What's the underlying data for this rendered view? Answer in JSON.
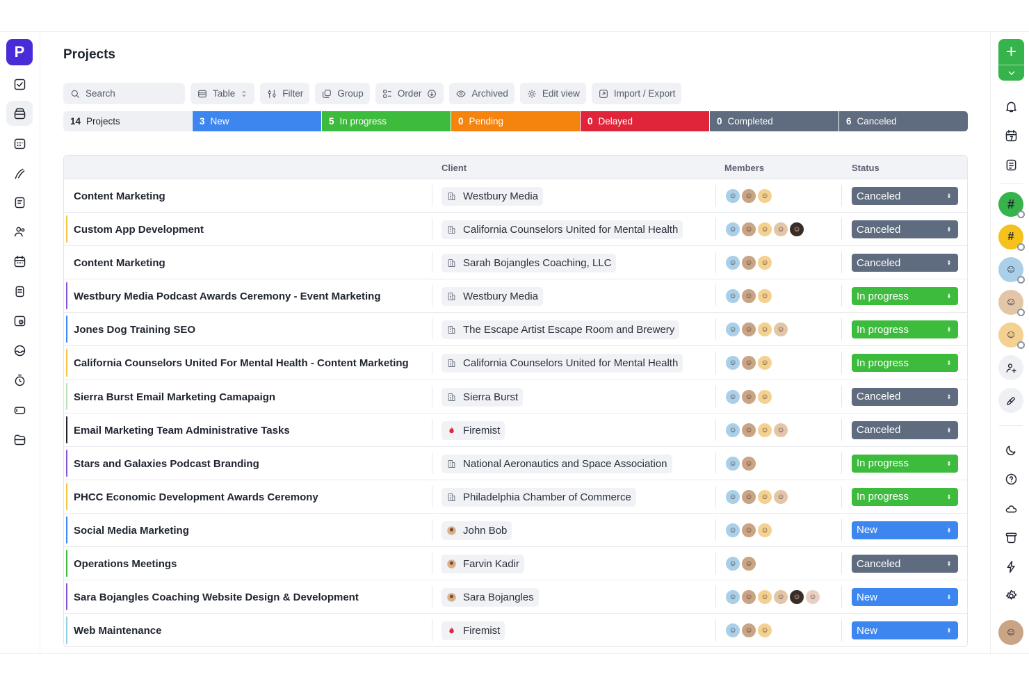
{
  "app": {
    "logo_letter": "P"
  },
  "page": {
    "title": "Projects"
  },
  "toolbar": {
    "search_placeholder": "Search",
    "table_label": "Table",
    "filter_label": "Filter",
    "group_label": "Group",
    "order_label": "Order",
    "archived_label": "Archived",
    "edit_view_label": "Edit view",
    "import_export_label": "Import / Export"
  },
  "status_summary": [
    {
      "count": "14",
      "label": "Projects",
      "kind": "total"
    },
    {
      "count": "3",
      "label": "New",
      "kind": "new"
    },
    {
      "count": "5",
      "label": "In progress",
      "kind": "progress"
    },
    {
      "count": "0",
      "label": "Pending",
      "kind": "pending"
    },
    {
      "count": "0",
      "label": "Delayed",
      "kind": "delayed"
    },
    {
      "count": "0",
      "label": "Completed",
      "kind": "completed"
    },
    {
      "count": "6",
      "label": "Canceled",
      "kind": "canceled"
    }
  ],
  "table": {
    "columns": {
      "client": "Client",
      "members": "Members",
      "status": "Status"
    },
    "rows": [
      {
        "name": "Content Marketing",
        "client": "Westbury Media",
        "client_icon": "building-icon",
        "members": 3,
        "status": "Canceled",
        "accent": "#ffffff"
      },
      {
        "name": "Custom App Development",
        "client": "California Counselors United for Mental Health",
        "client_icon": "building-icon",
        "members": 5,
        "status": "Canceled",
        "accent": "#f5c542"
      },
      {
        "name": "Content Marketing",
        "client": "Sarah Bojangles Coaching, LLC",
        "client_icon": "building-icon",
        "members": 3,
        "status": "Canceled",
        "accent": "#ffffff"
      },
      {
        "name": "Westbury Media Podcast Awards Ceremony - Event Marketing",
        "client": "Westbury Media",
        "client_icon": "building-icon",
        "members": 3,
        "status": "In progress",
        "accent": "#8c55d9"
      },
      {
        "name": "Jones Dog Training SEO",
        "client": "The Escape Artist Escape Room and Brewery",
        "client_icon": "building-icon",
        "members": 4,
        "status": "In progress",
        "accent": "#3d86f0"
      },
      {
        "name": "California Counselors United For Mental Health - Content Marketing",
        "client": "California Counselors United for Mental Health",
        "client_icon": "building-icon",
        "members": 3,
        "status": "In progress",
        "accent": "#f5c542"
      },
      {
        "name": "Sierra Burst Email Marketing Camapaign",
        "client": "Sierra Burst",
        "client_icon": "building-icon",
        "members": 3,
        "status": "Canceled",
        "accent": "#b5e3b1"
      },
      {
        "name": "Email Marketing Team Administrative Tasks",
        "client": "Firemist",
        "client_icon": "flame-icon",
        "members": 4,
        "status": "Canceled",
        "accent": "#1f2430"
      },
      {
        "name": "Stars and Galaxies Podcast Branding",
        "client": "National Aeronautics and Space Association",
        "client_icon": "building-icon",
        "members": 2,
        "status": "In progress",
        "accent": "#8c55d9"
      },
      {
        "name": "PHCC Economic Development Awards Ceremony",
        "client": "Philadelphia Chamber of Commerce",
        "client_icon": "building-icon",
        "members": 4,
        "status": "In progress",
        "accent": "#f5c542"
      },
      {
        "name": "Social Media Marketing",
        "client": "John Bob",
        "client_icon": "person-avatar-icon",
        "members": 3,
        "status": "New",
        "accent": "#3d86f0"
      },
      {
        "name": "Operations Meetings",
        "client": "Farvin Kadir",
        "client_icon": "person-avatar-icon",
        "members": 2,
        "status": "Canceled",
        "accent": "#3dbb3c"
      },
      {
        "name": "Sara Bojangles Coaching Website Design & Development",
        "client": "Sara Bojangles",
        "client_icon": "person-avatar-icon",
        "members": 6,
        "status": "New",
        "accent": "#8c55d9"
      },
      {
        "name": "Web Maintenance",
        "client": "Firemist",
        "client_icon": "flame-icon",
        "members": 3,
        "status": "New",
        "accent": "#8fd0e6"
      }
    ]
  },
  "colors": {
    "brand": "#4a2bd8",
    "new": "#3d86f0",
    "in_progress": "#3dbb3c",
    "pending": "#f5840f",
    "delayed": "#e0253a",
    "canceled": "#5f6b7e"
  }
}
